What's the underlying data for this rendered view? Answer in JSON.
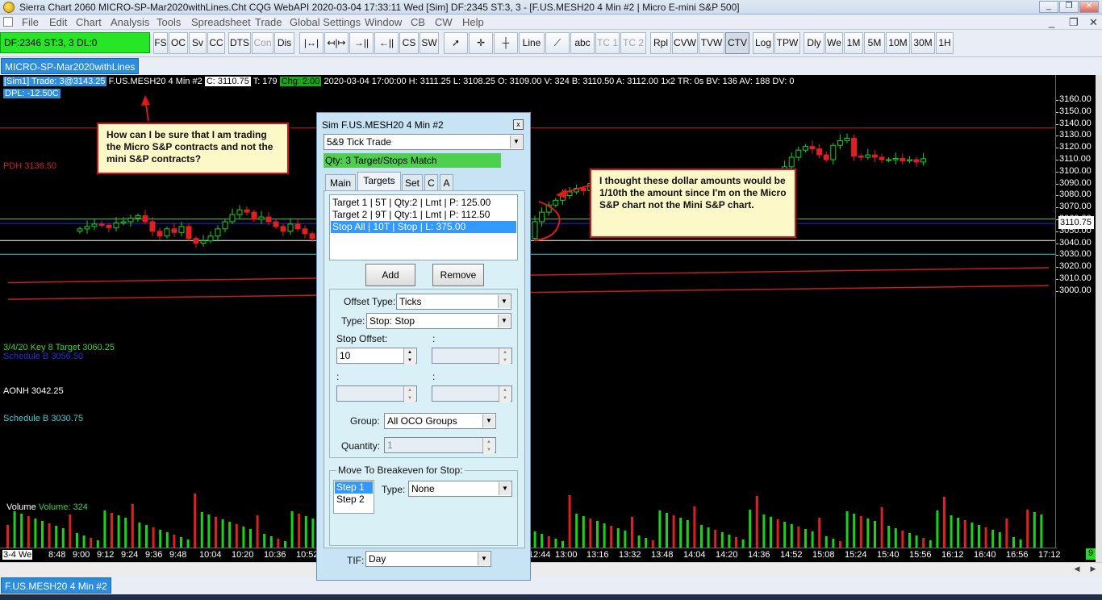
{
  "window": {
    "title": "Sierra Chart 2060 MICRO-SP-Mar2020withLines.Cht  CQG WebAPI 2020-03-04  17:33:11 Wed [Sim]  DF:2345  ST:3, 3 - [F.US.MESH20  4 Min   #2 | Micro E-mini S&P 500]"
  },
  "menu": [
    "File",
    "Edit",
    "Chart",
    "Analysis",
    "Tools",
    "Spreadsheet",
    "Trade",
    "Global Settings",
    "Window",
    "CB",
    "CW",
    "Help"
  ],
  "dfbox": "DF:2346  ST:3, 3  DL:0",
  "toolbar": [
    "FS",
    "OC",
    "Sv",
    "CC",
    "DTS",
    "Con",
    "Dis",
    "Line",
    "abc",
    "TC 1",
    "TC 2",
    "Rpl",
    "CVW",
    "TVW",
    "CTV",
    "Log",
    "TPW",
    "Dly",
    "We",
    "1M",
    "5M",
    "10M",
    "30M",
    "1H"
  ],
  "chart_tab": "MICRO-SP-Mar2020withLines",
  "bottom_tab": "F.US.MESH20  4 Min   #2",
  "info": {
    "sim": "[Sim1]  Trade: 3@3143.25",
    "symbol": "F.US.MESH20  4 Min   #2",
    "close": "C: 3110.75",
    "trades": "T: 179",
    "chg": "Chg: 2.00",
    "rest": "2020-03-04 17:00:00 H: 3111.25  L: 3108.25  O: 3109.00  V: 324  B: 3110.50  A: 3112.00  1x2  TR: 0s  BV: 136  AV: 188  DV: 0",
    "dpl": "DPL: -12.50C"
  },
  "levels": {
    "pdh": "PDH    3136.50",
    "key": "3/4/20 Key 8 Target    3060.25",
    "schedB1": "Schedule B    3056.50",
    "aonh": "AONH    3042.25",
    "schedB2": "Schedule B    3030.75"
  },
  "volume_label": "Volume",
  "volume_value": "Volume: 324",
  "price_labels": [
    "3160.00",
    "3150.00",
    "3140.00",
    "3130.00",
    "3120.00",
    "3110.00",
    "3100.00",
    "3090.00",
    "3080.00",
    "3070.00",
    "3060.00",
    "3050.00",
    "3040.00",
    "3030.00",
    "3020.00",
    "3010.00",
    "3000.00"
  ],
  "current_price": "3110.75",
  "time_labels": [
    "3-4 We",
    "8:48",
    "9:00",
    "9:12",
    "9:24",
    "9:36",
    "9:48",
    "10:04",
    "10:20",
    "10:36",
    "10:52",
    "12:44",
    "13:00",
    "13:16",
    "13:32",
    "13:48",
    "14:04",
    "14:20",
    "14:36",
    "14:52",
    "15:08",
    "15:24",
    "15:40",
    "15:56",
    "16:12",
    "16:40",
    "16:56",
    "17:12"
  ],
  "corner_badge": "9",
  "notes": {
    "n1": "How can I be sure that I am trading the Micro S&P contracts and not the mini S&P contracts?",
    "n2": "I thought these dollar amounts would be 1/10th the amount since I'm on the Micro S&P chart not the Mini S&P chart."
  },
  "dialog": {
    "title": "Sim F.US.MESH20  4 Min   #2",
    "close": "x",
    "strategy": "5&9 Tick Trade",
    "qty_status": "Qty: 3 Target/Stops Match",
    "tabs": [
      "Main",
      "Targets",
      "Set",
      "C",
      "A"
    ],
    "list": [
      "Target 1 | 5T | Qty:2 | Lmt | P: 125.00",
      "Target 2 | 9T | Qty:1 | Lmt | P: 112.50",
      "Stop All | 10T | Stop | L: 375.00"
    ],
    "add": "Add",
    "remove": "Remove",
    "offset_type_label": "Offset Type:",
    "offset_type": "Ticks",
    "type_label": "Type:",
    "type": "Stop: Stop",
    "stop_offset_label": "Stop Offset:",
    "colon": ":",
    "stop_offset": "10",
    "group_label": "Group:",
    "group": "All OCO Groups",
    "quantity_label": "Quantity:",
    "quantity": "1",
    "breakeven_label": "Move To Breakeven for Stop:",
    "steps": [
      "Step 1",
      "Step 2"
    ],
    "be_type_label": "Type:",
    "be_type": "None",
    "tif_label": "TIF:",
    "tif": "Day"
  },
  "colors": {
    "bull": "#18d418",
    "bear": "#e02020",
    "pdh": "#cc2222",
    "key": "#3fcf3f",
    "schedB1": "#2a2ae0",
    "schedB2": "#3fc9d9",
    "aonh": "#ffffff"
  }
}
